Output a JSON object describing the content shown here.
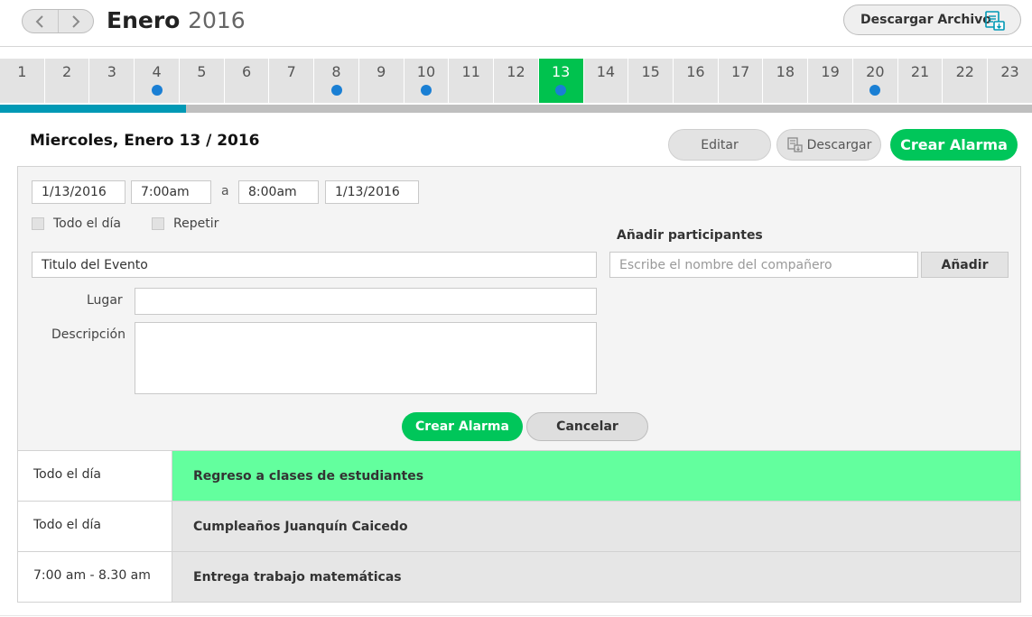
{
  "header": {
    "month": "Enero",
    "year": "2016",
    "download_archive_label": "Descargar Archivo"
  },
  "days": [
    {
      "num": "1",
      "dot": false,
      "active": false
    },
    {
      "num": "2",
      "dot": false,
      "active": false
    },
    {
      "num": "3",
      "dot": false,
      "active": false
    },
    {
      "num": "4",
      "dot": true,
      "active": false
    },
    {
      "num": "5",
      "dot": false,
      "active": false
    },
    {
      "num": "6",
      "dot": false,
      "active": false
    },
    {
      "num": "7",
      "dot": false,
      "active": false
    },
    {
      "num": "8",
      "dot": true,
      "active": false
    },
    {
      "num": "9",
      "dot": false,
      "active": false
    },
    {
      "num": "10",
      "dot": true,
      "active": false
    },
    {
      "num": "11",
      "dot": false,
      "active": false
    },
    {
      "num": "12",
      "dot": false,
      "active": false
    },
    {
      "num": "13",
      "dot": true,
      "active": true
    },
    {
      "num": "14",
      "dot": false,
      "active": false
    },
    {
      "num": "15",
      "dot": false,
      "active": false
    },
    {
      "num": "16",
      "dot": false,
      "active": false
    },
    {
      "num": "17",
      "dot": false,
      "active": false
    },
    {
      "num": "18",
      "dot": false,
      "active": false
    },
    {
      "num": "19",
      "dot": false,
      "active": false
    },
    {
      "num": "20",
      "dot": true,
      "active": false
    },
    {
      "num": "21",
      "dot": false,
      "active": false
    },
    {
      "num": "22",
      "dot": false,
      "active": false
    },
    {
      "num": "23",
      "dot": false,
      "active": false
    }
  ],
  "progress_fraction": 0.18,
  "date_heading": "Miercoles, Enero 13 / 2016",
  "toolbar": {
    "edit_label": "Editar",
    "download_label": "Descargar",
    "create_alarm_label": "Crear Alarma"
  },
  "form": {
    "start_date": "1/13/2016",
    "start_time": "7:00am",
    "separator": "a",
    "end_time": "8:00am",
    "end_date": "1/13/2016",
    "all_day_label": "Todo el día",
    "repeat_label": "Repetir",
    "event_title_value": "Titulo del Evento",
    "place_label": "Lugar",
    "place_value": "",
    "description_label": "Descripción",
    "description_value": "",
    "participants_heading": "Añadir participantes",
    "participants_placeholder": "Escribe el nombre del compañero",
    "add_label": "Añadir",
    "create_alarm_label": "Crear Alarma",
    "cancel_label": "Cancelar"
  },
  "events": [
    {
      "time": "Todo el día",
      "title": "Regreso a clases de estudiantes",
      "highlight": true
    },
    {
      "time": "Todo el día",
      "title": "Cumpleaños Juanquín Caicedo",
      "highlight": false
    },
    {
      "time": "7:00 am - 8.30 am",
      "title": "Entrega trabajo matemáticas",
      "highlight": false
    }
  ],
  "colors": {
    "accent_green": "#00c65a",
    "active_day": "#00c24e",
    "event_dot": "#1a7fd4",
    "progress": "#0099b5",
    "highlight_event": "#63ff9e"
  }
}
